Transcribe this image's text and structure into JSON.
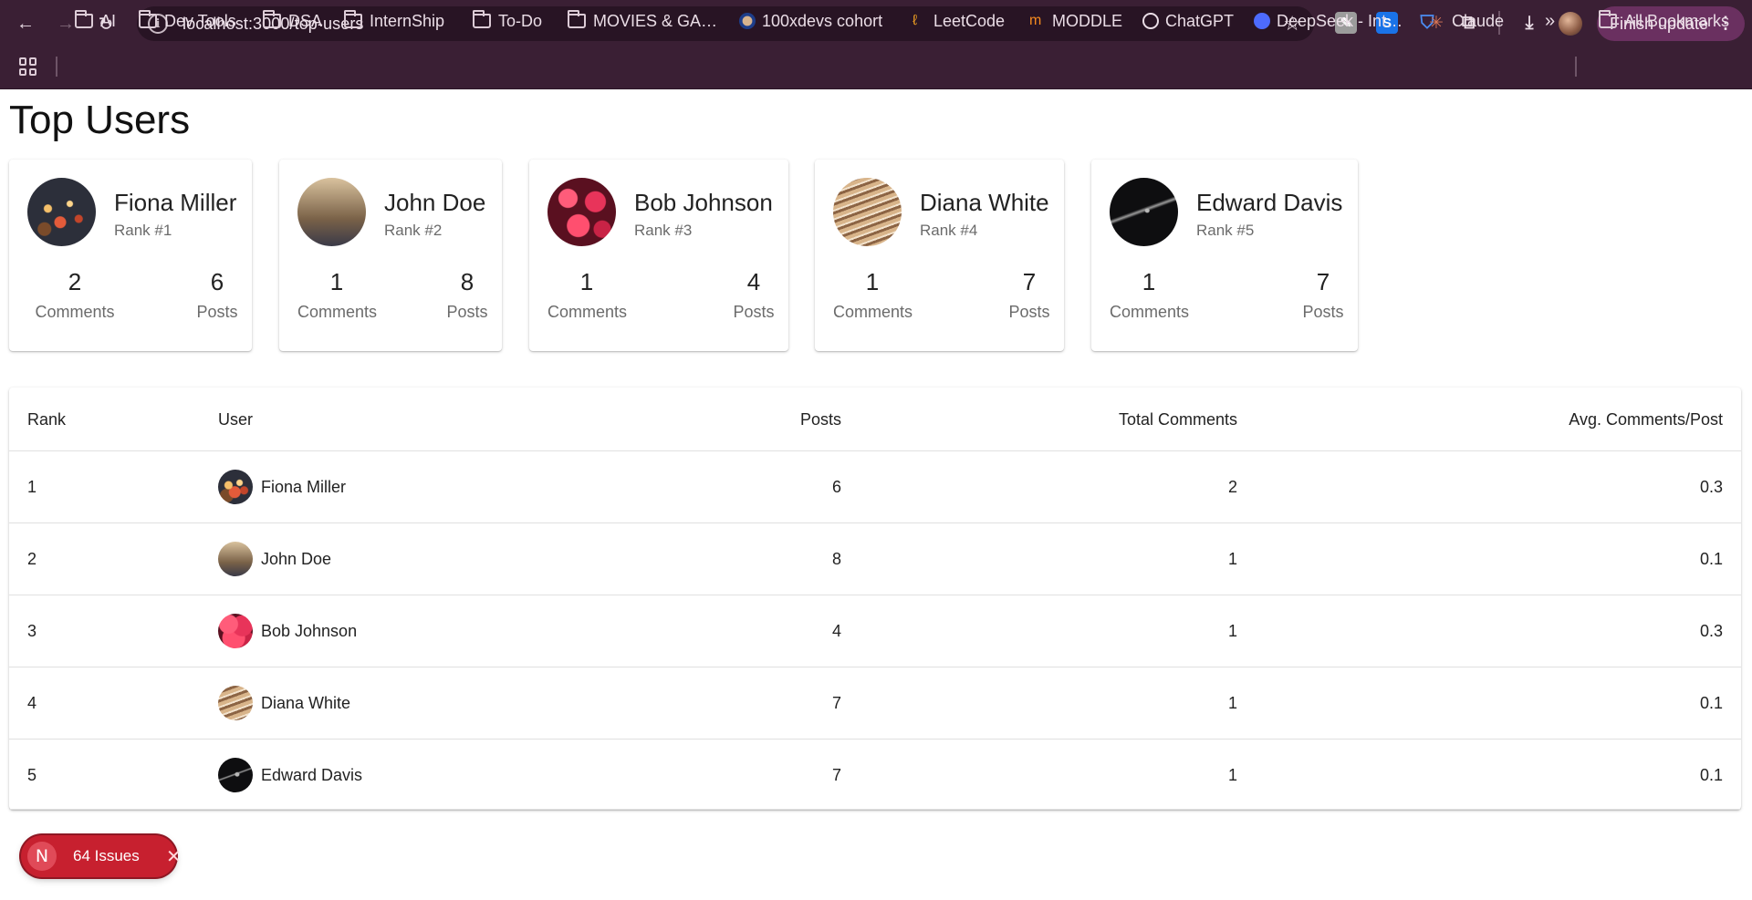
{
  "browser": {
    "url": "localhost:3000/top-users",
    "update_label": "Finish update",
    "bookmarks": [
      {
        "label": "AI",
        "type": "folder"
      },
      {
        "label": "Dev Tools",
        "type": "folder"
      },
      {
        "label": "DSA",
        "type": "folder"
      },
      {
        "label": "InternShip",
        "type": "folder"
      },
      {
        "label": "To-Do",
        "type": "folder"
      },
      {
        "label": "MOVIES & GA…",
        "type": "folder"
      },
      {
        "label": "100xdevs cohort",
        "type": "site"
      },
      {
        "label": "LeetCode",
        "type": "site"
      },
      {
        "label": "MODDLE",
        "type": "site"
      },
      {
        "label": "ChatGPT",
        "type": "site"
      },
      {
        "label": "DeepSeek - Int…",
        "type": "site"
      },
      {
        "label": "Claude",
        "type": "site"
      }
    ],
    "overflow_label": "»",
    "all_bookmarks_label": "All Bookmarks"
  },
  "page": {
    "title": "Top Users",
    "comments_label": "Comments",
    "posts_label": "Posts",
    "cards": [
      {
        "name": "Fiona Miller",
        "rank": "Rank #1",
        "comments": "2",
        "posts": "6"
      },
      {
        "name": "John Doe",
        "rank": "Rank #2",
        "comments": "1",
        "posts": "8"
      },
      {
        "name": "Bob Johnson",
        "rank": "Rank #3",
        "comments": "1",
        "posts": "4"
      },
      {
        "name": "Diana White",
        "rank": "Rank #4",
        "comments": "1",
        "posts": "7"
      },
      {
        "name": "Edward Davis",
        "rank": "Rank #5",
        "comments": "1",
        "posts": "7"
      }
    ]
  },
  "table": {
    "headers": [
      "Rank",
      "User",
      "Posts",
      "Total Comments",
      "Avg. Comments/Post"
    ],
    "rows": [
      {
        "rank": "1",
        "user": "Fiona Miller",
        "posts": "6",
        "comments": "2",
        "avg": "0.3"
      },
      {
        "rank": "2",
        "user": "John Doe",
        "posts": "8",
        "comments": "1",
        "avg": "0.1"
      },
      {
        "rank": "3",
        "user": "Bob Johnson",
        "posts": "4",
        "comments": "1",
        "avg": "0.3"
      },
      {
        "rank": "4",
        "user": "Diana White",
        "posts": "7",
        "comments": "1",
        "avg": "0.1"
      },
      {
        "rank": "5",
        "user": "Edward Davis",
        "posts": "7",
        "comments": "1",
        "avg": "0.1"
      }
    ]
  },
  "dev_overlay": {
    "logo_letter": "N",
    "issues_label": "64 Issues",
    "close_glyph": "✕"
  },
  "colors": {
    "chrome_bg": "#3a1f34",
    "update_button": "#6a3060",
    "issues_badge": "#c7202f"
  }
}
